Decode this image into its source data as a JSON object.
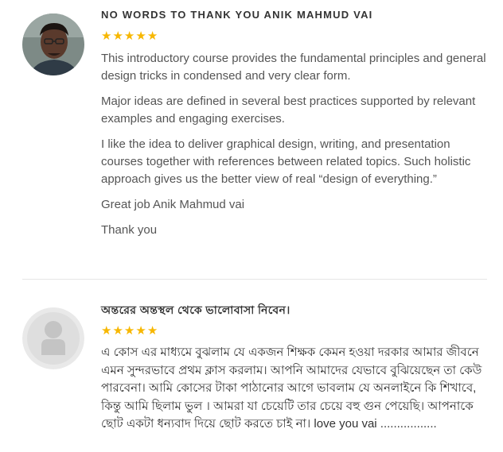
{
  "reviews": [
    {
      "avatar": "photo-avatar",
      "title": "NO WORDS TO THANK YOU ANIK MAHMUD VAI",
      "rating": 5,
      "paragraphs": [
        "This introductory course provides the fundamental principles and general design tricks in condensed and very clear form.",
        "Major ideas are defined in several best practices supported by relevant examples and engaging exercises.",
        "I like the idea to deliver graphical design, writing, and presentation courses together with references between related topics. Such holistic approach gives us the better view of real “design of everything.”",
        "Great job Anik Mahmud vai",
        "Thank you"
      ]
    },
    {
      "avatar": "default-user-avatar",
      "title": "অন্তরের অন্তস্থল থেকে ভালোবাসা নিবেন।",
      "rating": 5,
      "paragraphs": [
        "এ কোস এর মাধ্যমে বুঝলাম যে একজন শিক্ষক কেমন হওয়া দরকার আমার জীবনে এমন সুন্দরভাবে প্রথম ক্লাস করলাম। আপনি আমাদের যেভাবে বুঝিয়েছেন তা কেউ পারবেনা। আমি কোসের টাকা পাঠানোর আগে ভাবলাম যে অনলাইনে কি শিখাবে, কিন্তু আমি ছিলাম ভুল । আমরা যা চেয়েটি তার চেয়ে বহু গুন পেয়েছি। আপনাকে ছোট একটা ধন্যবাদ দিয়ে ছোট করতে চাই না। love you vai ................."
      ]
    }
  ],
  "colors": {
    "star": "#f7b700",
    "text": "#555555",
    "title": "#333333",
    "divider": "#e6e6e6"
  }
}
